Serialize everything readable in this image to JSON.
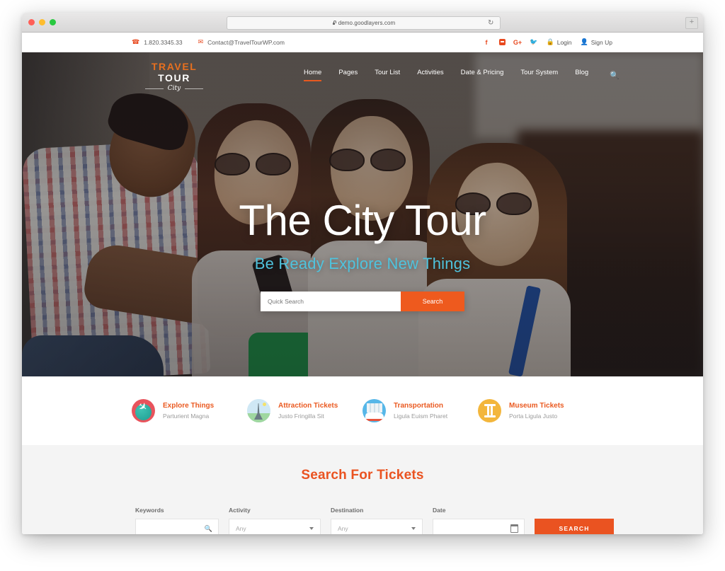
{
  "browser": {
    "url": "demo.goodlayers.com",
    "lock_icon": "lock-icon",
    "reload_icon": "reload-icon",
    "newtab_label": "+"
  },
  "topbar": {
    "phone": "1.820.3345.33",
    "email": "Contact@TravelTourWP.com",
    "phone_icon": "phone-icon",
    "email_icon": "envelope-icon",
    "social": [
      {
        "name": "facebook-icon",
        "glyph": "f"
      },
      {
        "name": "instagram-icon",
        "glyph": ""
      },
      {
        "name": "google-plus-icon",
        "glyph": "G+"
      },
      {
        "name": "twitter-icon",
        "glyph": "✓"
      }
    ],
    "login_label": "Login",
    "signup_label": "Sign Up",
    "login_icon": "lock-icon",
    "signup_icon": "user-icon"
  },
  "logo": {
    "travel": "TRAVEL",
    "tour": "TOUR",
    "city": "City"
  },
  "nav": {
    "items": [
      {
        "label": "Home",
        "active": true
      },
      {
        "label": "Pages",
        "active": false
      },
      {
        "label": "Tour List",
        "active": false
      },
      {
        "label": "Activities",
        "active": false
      },
      {
        "label": "Date & Pricing",
        "active": false
      },
      {
        "label": "Tour System",
        "active": false
      },
      {
        "label": "Blog",
        "active": false
      }
    ],
    "search_icon": "search-icon"
  },
  "hero": {
    "title": "The City Tour",
    "subtitle": "Be Ready Explore New Things",
    "search_placeholder": "Quick Search",
    "search_button": "Search",
    "subtitle_color": "#4fc3dd",
    "accent_color": "#ee5a1e"
  },
  "features": [
    {
      "icon": "globe-plane-icon",
      "title": "Explore Things",
      "subtitle": "Parturient Magna"
    },
    {
      "icon": "eiffel-tower-icon",
      "title": "Attraction Tickets",
      "subtitle": "Justo Fringilla Sit"
    },
    {
      "icon": "train-city-icon",
      "title": "Transportation",
      "subtitle": "Ligula Euism Pharet"
    },
    {
      "icon": "museum-columns-icon",
      "title": "Museum Tickets",
      "subtitle": "Porta Ligula Justo"
    }
  ],
  "search_panel": {
    "title": "Search For Tickets",
    "accent_color": "#ea5321",
    "fields": [
      {
        "label": "Keywords",
        "value": "",
        "icon": "search-icon"
      },
      {
        "label": "Activity",
        "value": "Any",
        "icon": "chevron-down-icon"
      },
      {
        "label": "Destination",
        "value": "Any",
        "icon": "chevron-down-icon"
      },
      {
        "label": "Date",
        "value": "",
        "icon": "calendar-icon"
      }
    ],
    "submit_label": "SEARCH"
  }
}
